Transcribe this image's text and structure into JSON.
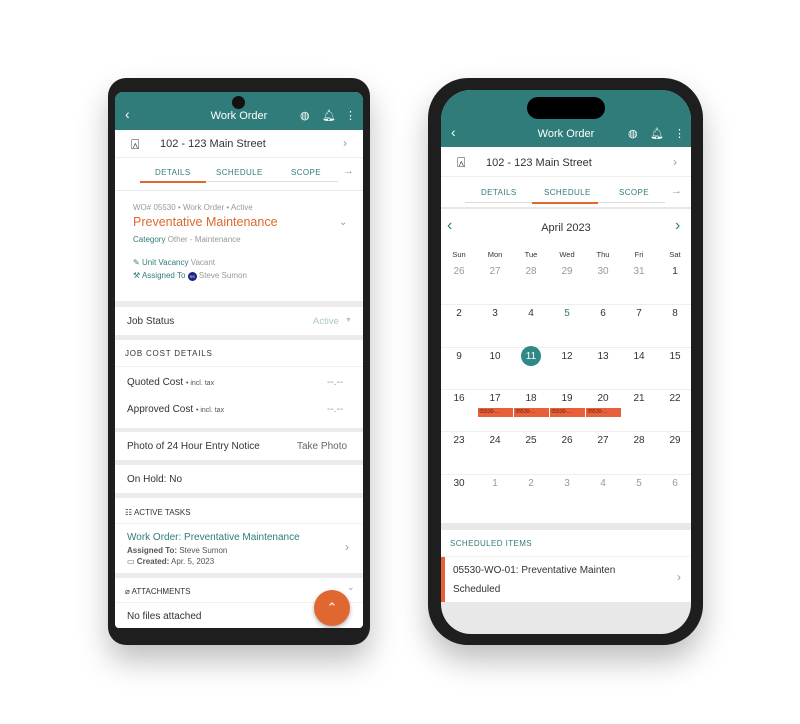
{
  "android": {
    "header": {
      "title": "Work Order",
      "icons": [
        "back-arrow-icon",
        "globe-icon",
        "bell-icon",
        "more-vertical-icon"
      ]
    },
    "property": "102 - 123 Main Street",
    "tabs": [
      {
        "label": "DETAILS",
        "active": true
      },
      {
        "label": "SCHEDULE"
      },
      {
        "label": "SCOPE"
      }
    ],
    "wo": {
      "meta": "WO# 05530 • Work Order • Active",
      "title": "Preventative Maintenance",
      "category_label": "Category",
      "category_value": "Other - Maintenance",
      "vacancy_label": "Unit Vacancy",
      "vacancy_value": "Vacant",
      "assigned_label": "Assigned To",
      "assigned_initials": "SS",
      "assigned_value": "Steve Sumon"
    },
    "job_status": {
      "label": "Job Status",
      "value": "Active"
    },
    "job_cost": {
      "heading": "JOB COST DETAILS",
      "quoted_label": "Quoted Cost",
      "approved_label": "Approved Cost",
      "tax_note": "• incl. tax",
      "quoted_value": "--.--",
      "approved_value": "--.--"
    },
    "photo": {
      "label": "Photo of 24 Hour Entry Notice",
      "action": "Take Photo"
    },
    "on_hold": "On Hold: No",
    "tasks": {
      "heading": "ACTIVE TASKS",
      "title": "Work Order: Preventative Maintenance",
      "assigned_label": "Assigned To:",
      "assigned_value": "Steve Sumon",
      "created_label": "Created:",
      "created_value": "Apr. 5, 2023"
    },
    "attachments": {
      "heading": "ATTACHMENTS",
      "empty": "No files attached"
    }
  },
  "iphone": {
    "header": {
      "title": "Work Order"
    },
    "property": "102 - 123 Main Street",
    "tabs": [
      {
        "label": "DETAILS"
      },
      {
        "label": "SCHEDULE",
        "active": true
      },
      {
        "label": "SCOPE"
      }
    ],
    "calendar": {
      "month": "April 2023",
      "weekdays": [
        "Sun",
        "Mon",
        "Tue",
        "Wed",
        "Thu",
        "Fri",
        "Sat"
      ],
      "weeks": [
        [
          "26",
          "27",
          "28",
          "29",
          "30",
          "31",
          "1"
        ],
        [
          "2",
          "3",
          "4",
          "5",
          "6",
          "7",
          "8"
        ],
        [
          "9",
          "10",
          "11",
          "12",
          "13",
          "14",
          "15"
        ],
        [
          "16",
          "17",
          "18",
          "19",
          "20",
          "21",
          "22"
        ],
        [
          "23",
          "24",
          "25",
          "26",
          "27",
          "28",
          "29"
        ],
        [
          "30",
          "1",
          "2",
          "3",
          "4",
          "5",
          "6"
        ]
      ],
      "today": "11",
      "highlight": "5",
      "event_label": "05530-...",
      "event_days": [
        "17",
        "18",
        "19",
        "20"
      ]
    },
    "scheduled": {
      "heading": "SCHEDULED ITEMS",
      "title": "05530-WO-01: Preventative Mainten",
      "status": "Scheduled"
    }
  },
  "colors": {
    "teal": "#2f7c7a",
    "orange": "#e0672f"
  }
}
